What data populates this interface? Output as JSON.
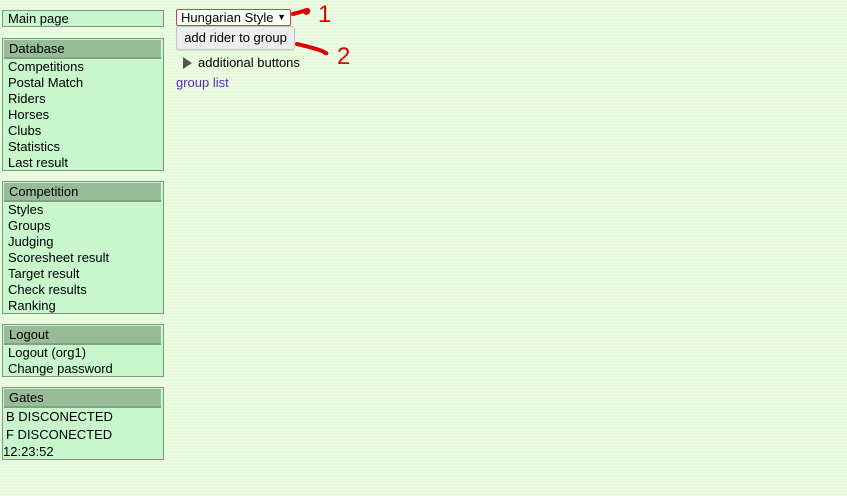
{
  "sidebar": {
    "main_page": "Main page",
    "database": {
      "title": "Database",
      "items": [
        "Competitions",
        "Postal Match",
        "Riders",
        "Horses",
        "Clubs",
        "Statistics",
        "Last result"
      ]
    },
    "competition": {
      "title": "Competition",
      "items": [
        "Styles",
        "Groups",
        "Judging",
        "Scoresheet result",
        "Target result",
        "Check results",
        "Ranking"
      ]
    },
    "logout": {
      "title": "Logout",
      "items": [
        "Logout (org1)",
        "Change password"
      ]
    },
    "gates": {
      "title": "Gates",
      "lines": [
        "B DISCONECTED",
        "F DISCONECTED"
      ],
      "time": "12:23:52"
    }
  },
  "main": {
    "style_select": {
      "value": "Hungarian Style",
      "arrow": "▼"
    },
    "add_rider_button": "add rider to group",
    "additional_buttons": "additional buttons",
    "group_list_link": "group list"
  },
  "annotations": {
    "label_1": "1",
    "label_2": "2",
    "color": "#e00000"
  },
  "colors": {
    "panel_bg": "#c8f7cc",
    "panel_header": "#98bb98",
    "page_bg": "#e6fbdc",
    "link": "#5a1fd0"
  }
}
